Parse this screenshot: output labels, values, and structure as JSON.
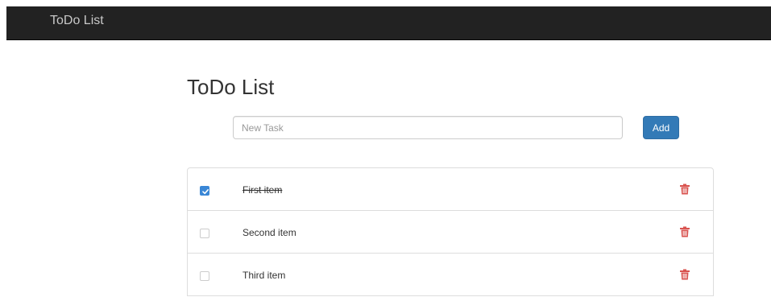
{
  "navbar": {
    "brand": "ToDo List",
    "background": "#222222"
  },
  "main": {
    "title": "ToDo List",
    "new_task": {
      "value": "",
      "placeholder": "New Task"
    },
    "add_label": "Add",
    "accent_color": "#337ab7",
    "delete_color": "#d9534f",
    "delete_icon": "trash-icon",
    "checked_icon": "checkmark-icon"
  },
  "tasks": [
    {
      "label": "First item",
      "done": true
    },
    {
      "label": "Second item",
      "done": false
    },
    {
      "label": "Third item",
      "done": false
    }
  ]
}
